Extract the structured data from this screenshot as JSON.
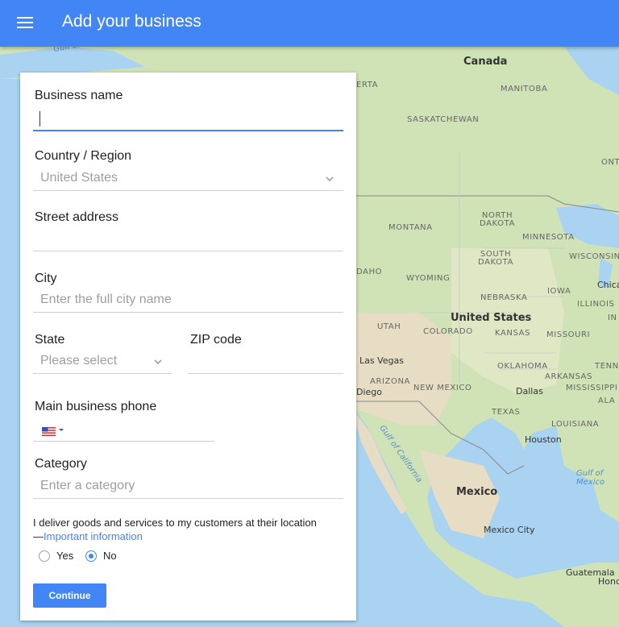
{
  "header": {
    "title": "Add your business",
    "menu_icon": "menu-icon",
    "bg_color": "#4285f4"
  },
  "form": {
    "business_name": {
      "label": "Business name",
      "value": "",
      "placeholder": ""
    },
    "country": {
      "label": "Country / Region",
      "selected": "United States"
    },
    "street": {
      "label": "Street address",
      "value": ""
    },
    "city": {
      "label": "City",
      "placeholder": "Enter the full city name"
    },
    "state": {
      "label": "State",
      "placeholder": "Please select"
    },
    "zip": {
      "label": "ZIP code",
      "value": ""
    },
    "phone": {
      "label": "Main business phone",
      "country_flag": "us-flag-icon",
      "value": ""
    },
    "category": {
      "label": "Category",
      "placeholder": "Enter a category"
    },
    "delivery_question": {
      "text": "I deliver goods and services to my customers at their location",
      "dash": "—",
      "link_text": "Important information",
      "options": [
        "Yes",
        "No"
      ],
      "selected": "No"
    },
    "continue_label": "Continue"
  },
  "map": {
    "countries": [
      "Canada",
      "United States",
      "Mexico"
    ],
    "regions": [
      "ERTA",
      "MANITOBA",
      "SASKATCHEWAN",
      "ONT",
      "NORTH DAKOTA",
      "MONTANA",
      "MINNESOTA",
      "SOUTH DAKOTA",
      "WISCONSIN",
      "DAHO",
      "WYOMING",
      "NEBRASKA",
      "IOWA",
      "ILLINOIS",
      "IN",
      "UTAH",
      "COLORADO",
      "KANSAS",
      "MISSOURI",
      "OKLAHOMA",
      "TENN",
      "ARKANSAS",
      "ARIZONA",
      "NEW MEXICO",
      "MISSISSIPPI",
      "ALA",
      "TEXAS",
      "LOUISIANA"
    ],
    "cities": [
      "Chica",
      "Las Vegas",
      "Diego",
      "Dallas",
      "Houston",
      "Mexico City",
      "Guatemala",
      "Hond"
    ],
    "water": [
      "Gulf of Alaska",
      "Gulf of California",
      "Gulf of Mexico"
    ]
  }
}
